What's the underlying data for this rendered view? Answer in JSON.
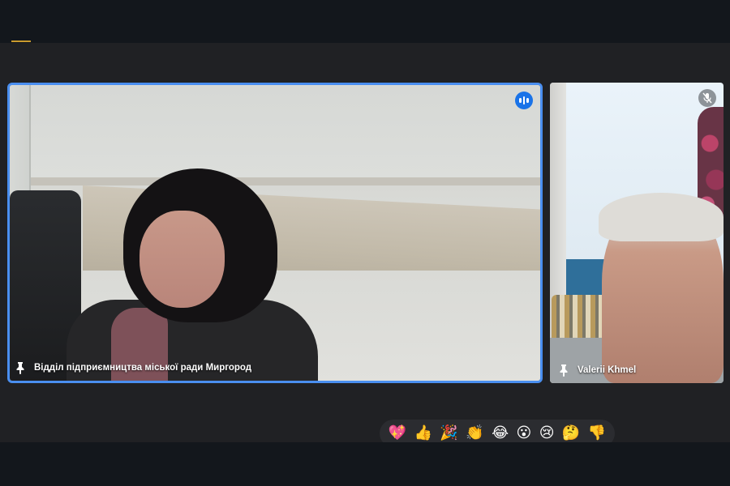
{
  "app": {
    "accent_color": "#c99a2e",
    "active_speaker_color": "#4a8ff0"
  },
  "participants": [
    {
      "name": "Відділ підприємництва міської ради Миргород",
      "state": "speaking",
      "pinned_icon": "pin-icon"
    },
    {
      "name": "Valerii Khmel",
      "state": "muted",
      "pinned_icon": "pin-icon"
    }
  ],
  "reactions": [
    {
      "name": "sparkling-heart",
      "glyph": "💖"
    },
    {
      "name": "thumbs-up",
      "glyph": "👍"
    },
    {
      "name": "party-popper",
      "glyph": "🎉"
    },
    {
      "name": "clapping-hands",
      "glyph": "👏"
    },
    {
      "name": "tears-of-joy",
      "glyph": "😂"
    },
    {
      "name": "surprised",
      "glyph": "😮"
    },
    {
      "name": "crying",
      "glyph": "😢"
    },
    {
      "name": "thinking",
      "glyph": "🤔"
    },
    {
      "name": "thumbs-down",
      "glyph": "👎"
    }
  ]
}
